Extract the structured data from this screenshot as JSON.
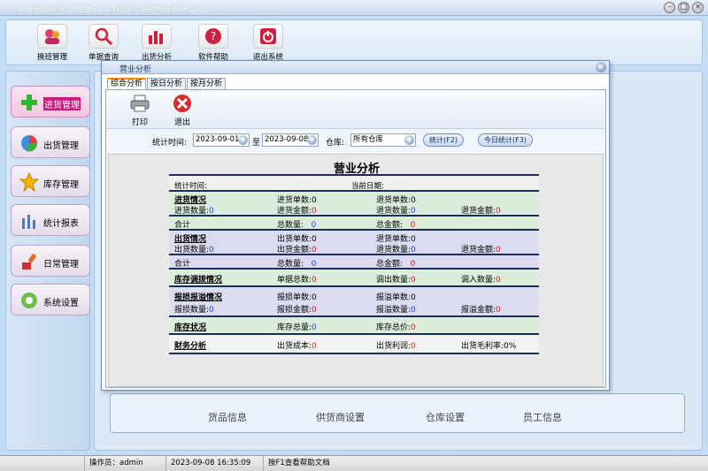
{
  "window": {
    "title": "库存管理系统 试用版V4.2 [北京卡瑞特科技有限公司]"
  },
  "toolbar": {
    "items": [
      {
        "label": "换班管理"
      },
      {
        "label": "单据查询"
      },
      {
        "label": "出货分析"
      },
      {
        "label": "软件帮助"
      },
      {
        "label": "退出系统"
      }
    ]
  },
  "sidebar": {
    "items": [
      {
        "label": "进货管理",
        "active": true
      },
      {
        "label": "出货管理"
      },
      {
        "label": "库存管理"
      },
      {
        "label": "统计报表"
      },
      {
        "label": "日常管理"
      },
      {
        "label": "系统设置"
      }
    ]
  },
  "bottom_links": [
    "货品信息",
    "供货商设置",
    "仓库设置",
    "员工信息"
  ],
  "status": {
    "operator": "操作员：admin",
    "datetime": "2023-09-08 16:35:09",
    "hint": "按F1查看帮助文档"
  },
  "dialog": {
    "title": "营业分析",
    "tabs": [
      "综合分析",
      "按日分析",
      "按月分析"
    ],
    "tools": {
      "print": "打印",
      "exit": "退出"
    },
    "filter": {
      "time_label": "统计时间:",
      "date_from": "2023-09-01",
      "to": "至",
      "date_to": "2023-09-08",
      "warehouse_label": "仓库:",
      "warehouse": "所有仓库",
      "stat_button": "统计(F2)",
      "today_button": "今日统计(F3)"
    },
    "report": {
      "title": "营业分析",
      "stat_time": "统计时间:",
      "current_date": "当前日期:",
      "purchase": {
        "heading": "进货情况",
        "in_count_label": "进货单数:",
        "in_count": "0",
        "ret_count_label": "退货单数:",
        "ret_count": "0",
        "in_qty_label": "进货数量:",
        "in_qty": "0",
        "in_amt_label": "进货金额:",
        "in_amt": "0",
        "ret_qty_label": "退货数量:",
        "ret_qty": "0",
        "ret_amt_label": "退货金额:",
        "ret_amt": "0",
        "total_label": "合计",
        "total_qty_label": "总数量:",
        "total_qty": "0",
        "total_amt_label": "总金额:",
        "total_amt": "0"
      },
      "sales": {
        "heading": "出货情况",
        "out_count_label": "出货单数:",
        "out_count": "0",
        "ret_count_label": "退货单数:",
        "ret_count": "0",
        "out_qty_label": "出货数量:",
        "out_qty": "0",
        "out_amt_label": "出货金额:",
        "out_amt": "0",
        "ret_qty_label": "退货数量:",
        "ret_qty": "0",
        "ret_amt_label": "退货金额:",
        "ret_amt": "0",
        "total_label": "合计",
        "total_qty_label": "总数量:",
        "total_qty": "0",
        "total_amt_label": "总金额:",
        "total_amt": "0"
      },
      "transfer": {
        "heading": "库存调拨情况",
        "count_label": "单据总数:",
        "count": "0",
        "out_label": "调出数量:",
        "out": "0",
        "in_label": "调入数量:",
        "in": "0"
      },
      "loss": {
        "heading": "报损报溢情况",
        "loss_count_label": "报损单数:",
        "loss_count": "0",
        "gain_count_label": "报溢单数:",
        "gain_count": "0",
        "loss_qty_label": "报损数量:",
        "loss_qty": "0",
        "loss_amt_label": "报损金额:",
        "loss_amt": "0",
        "gain_qty_label": "报溢数量:",
        "gain_qty": "0",
        "gain_amt_label": "报溢金额:",
        "gain_amt": "0"
      },
      "stock": {
        "heading": "库存状况",
        "total_qty_label": "库存总量:",
        "total_qty": "0",
        "total_price_label": "库存总价:",
        "total_price": "0"
      },
      "finance": {
        "heading": "财务分析",
        "cost_label": "出货成本:",
        "cost": "0",
        "profit_label": "出货利润:",
        "profit": "0",
        "margin_label": "出货毛利率:",
        "margin": "0%"
      }
    }
  }
}
